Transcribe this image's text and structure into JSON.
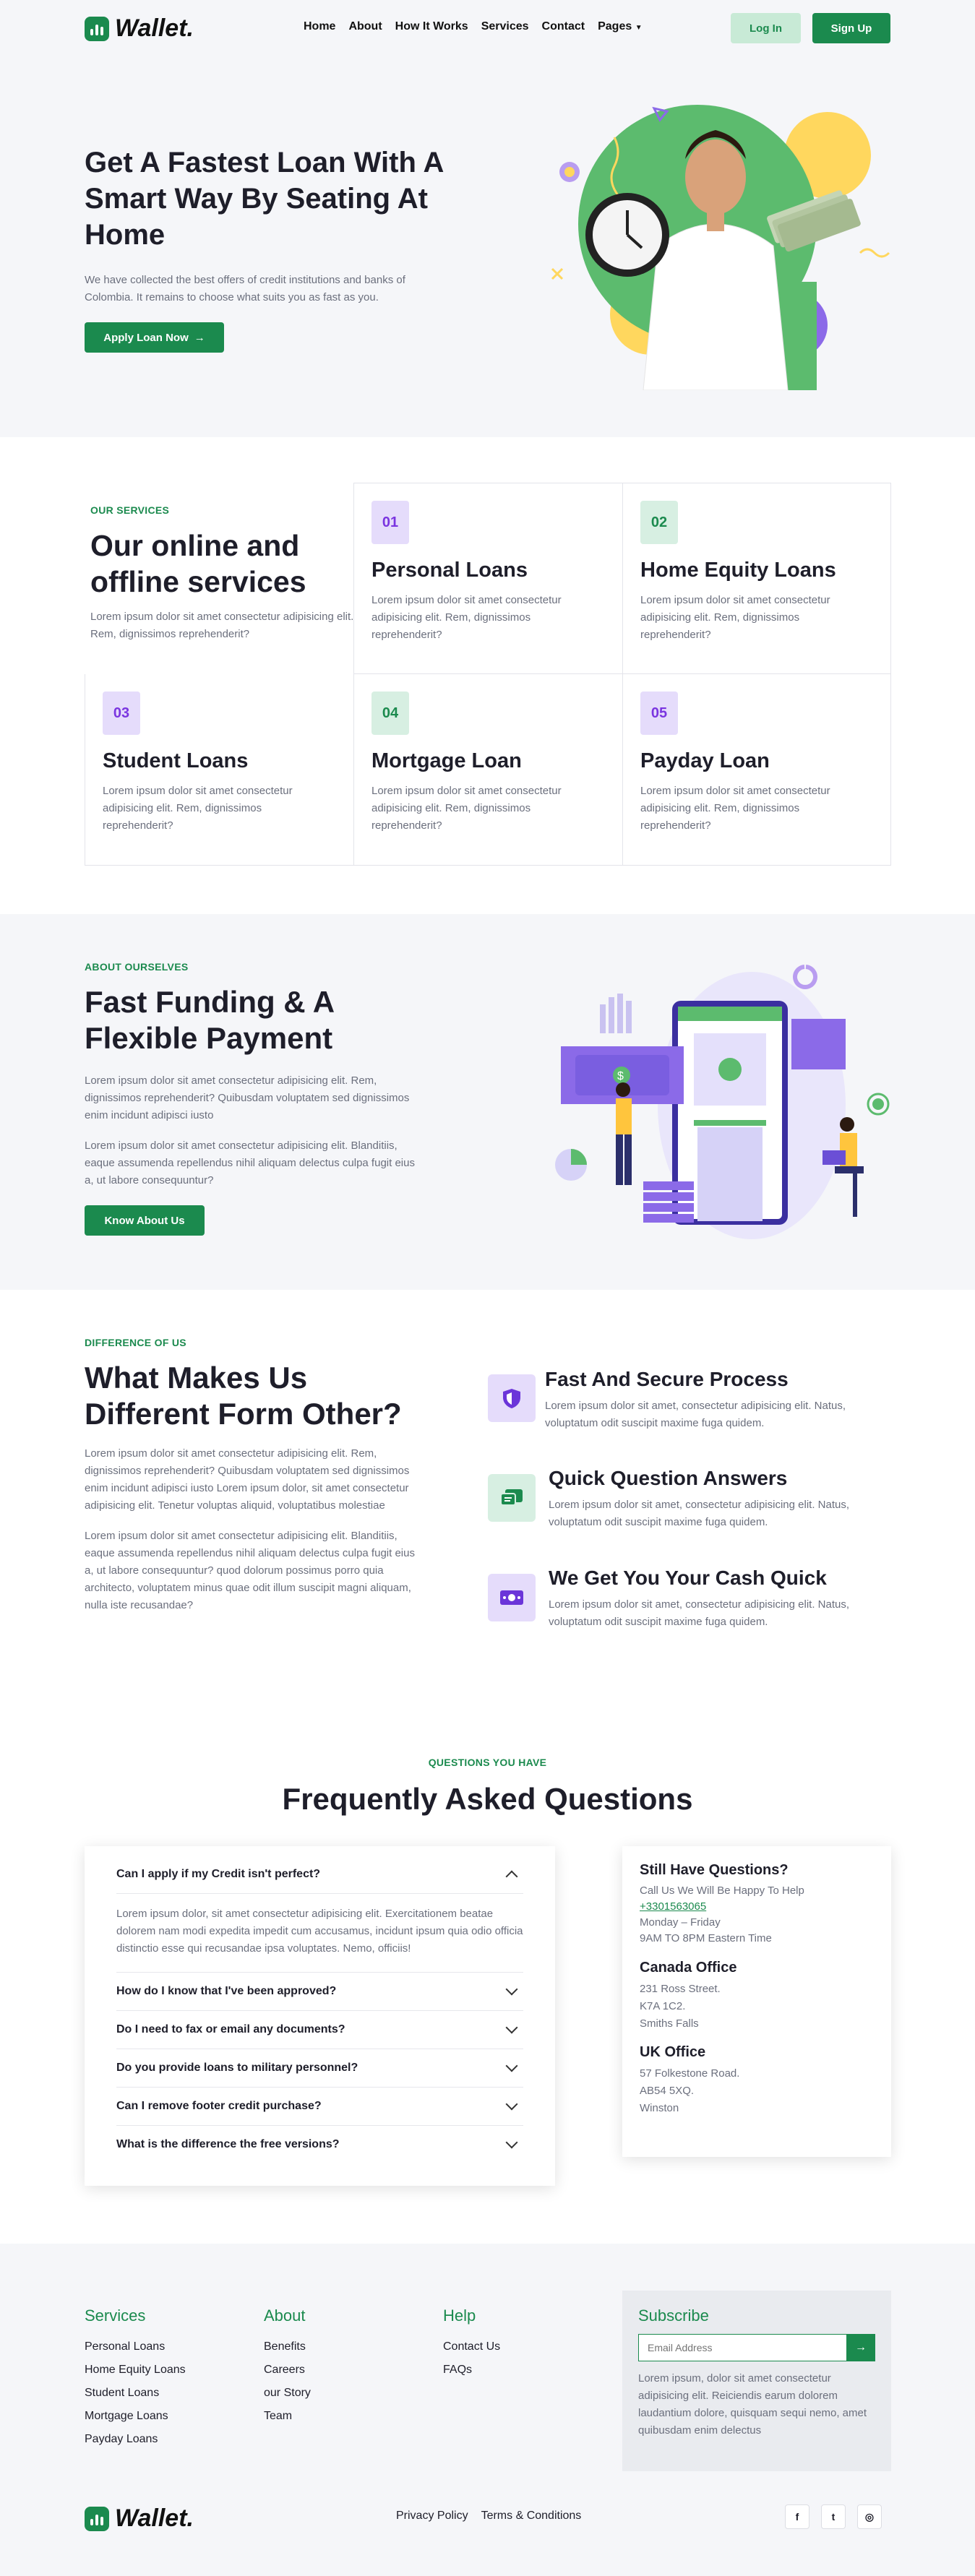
{
  "brand": {
    "logo_text": "Wallet.",
    "accent": "#1b8a4e",
    "purple": "#7a35e0"
  },
  "nav": {
    "items": [
      "Home",
      "About",
      "How It Works",
      "Services",
      "Contact",
      "Pages"
    ],
    "login": "Log In",
    "signup": "Sign Up"
  },
  "hero": {
    "title": "Get A Fastest Loan With A Smart Way By Seating At Home",
    "text": "We have collected the best offers of credit institutions and banks of Colombia. It remains to choose what suits you as fast as you.",
    "cta": "Apply Loan Now"
  },
  "services": {
    "tag": "OUR SERVICES",
    "title": "Our online and offline services",
    "text": "Lorem ipsum dolor sit amet consectetur adipisicing elit. Rem, dignissimos reprehenderit?",
    "items": [
      {
        "num": "01",
        "title": "Personal Loans",
        "desc": "Lorem ipsum dolor sit amet consectetur adipisicing elit. Rem, dignissimos reprehenderit?"
      },
      {
        "num": "02",
        "title": "Home Equity Loans",
        "desc": "Lorem ipsum dolor sit amet consectetur adipisicing elit. Rem, dignissimos reprehenderit?"
      },
      {
        "num": "03",
        "title": "Student Loans",
        "desc": "Lorem ipsum dolor sit amet consectetur adipisicing elit. Rem, dignissimos reprehenderit?"
      },
      {
        "num": "04",
        "title": "Mortgage Loan",
        "desc": "Lorem ipsum dolor sit amet consectetur adipisicing elit. Rem, dignissimos reprehenderit?"
      },
      {
        "num": "05",
        "title": "Payday Loan",
        "desc": "Lorem ipsum dolor sit amet consectetur adipisicing elit. Rem, dignissimos reprehenderit?"
      }
    ]
  },
  "about": {
    "tag": "ABOUT OURSELVES",
    "title": "Fast Funding & A Flexible Payment",
    "p1": "Lorem ipsum dolor sit amet consectetur adipisicing elit. Rem, dignissimos reprehenderit? Quibusdam voluptatem sed dignissimos enim incidunt adipisci iusto",
    "p2": "Lorem ipsum dolor sit amet consectetur adipisicing elit. Blanditiis, eaque assumenda repellendus nihil aliquam delectus culpa fugit eius a, ut labore consequuntur?",
    "cta": "Know About Us",
    "illustration_icon": "dollar-icon"
  },
  "difference": {
    "tag": "DIFFERENCE OF US",
    "title": "What Makes Us Different Form Other?",
    "p1": "Lorem ipsum dolor sit amet consectetur adipisicing elit. Rem, dignissimos reprehenderit? Quibusdam voluptatem sed dignissimos enim incidunt adipisci iusto Lorem ipsum dolor, sit amet consectetur adipisicing elit. Tenetur voluptas aliquid, voluptatibus molestiae",
    "p2": "Lorem ipsum dolor sit amet consectetur adipisicing elit. Blanditiis, eaque assumenda repellendus nihil aliquam delectus culpa fugit eius a, ut labore consequuntur? quod dolorum possimus porro quia architecto, voluptatem minus quae odit illum suscipit magni aliquam, nulla iste recusandae?",
    "features": [
      {
        "icon": "shield-icon",
        "title": "Fast And Secure Process",
        "desc": "Lorem ipsum dolor sit amet, consectetur adipisicing elit. Natus, voluptatum odit suscipit maxime fuga quidem."
      },
      {
        "icon": "chat-icon",
        "title": "Quick Question Answers",
        "desc": "Lorem ipsum dolor sit amet, consectetur adipisicing elit. Natus, voluptatum odit suscipit maxime fuga quidem."
      },
      {
        "icon": "cash-icon",
        "title": "We Get You Your Cash Quick",
        "desc": "Lorem ipsum dolor sit amet, consectetur adipisicing elit. Natus, voluptatum odit suscipit maxime fuga quidem."
      }
    ]
  },
  "faq": {
    "tag": "QUESTIONS YOU HAVE",
    "title": "Frequently Asked Questions",
    "open_q": "Can I apply if my Credit isn't perfect?",
    "open_a": "Lorem ipsum dolor, sit amet consectetur adipisicing elit. Exercitationem beatae dolorem nam modi expedita impedit cum accusamus, incidunt ipsum quia odio officia distinctio esse qui recusandae ipsa voluptates. Nemo, officiis!",
    "items": [
      "How do I know that I've been approved?",
      "Do I need to fax or email any documents?",
      "Do you provide loans to military personnel?",
      "Can I remove footer credit purchase?",
      "What is the difference the free versions?"
    ]
  },
  "contact_card": {
    "title": "Still Have Questions?",
    "sub": "Call Us We Will Be Happy To Help",
    "phone": "+3301563065",
    "days": "Monday – Friday",
    "hours": "9AM TO 8PM Eastern Time",
    "canada_title": "Canada Office",
    "canada_lines": [
      "231 Ross Street.",
      "K7A 1C2.",
      "Smiths Falls"
    ],
    "uk_title": "UK Office",
    "uk_lines": [
      "57 Folkestone Road.",
      "AB54 5XQ.",
      "Winston"
    ]
  },
  "footer": {
    "services_title": "Services",
    "services": [
      "Personal Loans",
      "Home Equity Loans",
      "Student Loans",
      "Mortgage Loans",
      "Payday Loans"
    ],
    "about_title": "About",
    "about": [
      "Benefits",
      "Careers",
      "our Story",
      "Team"
    ],
    "help_title": "Help",
    "help": [
      "Contact Us",
      "FAQs"
    ],
    "subscribe_title": "Subscribe",
    "email_placeholder": "Email Address",
    "subscribe_text": "Lorem ipsum, dolor sit amet consectetur adipisicing elit. Reiciendis earum dolorem laudantium dolore, quisquam sequi nemo, amet quibusdam enim delectus",
    "logo_text": "Wallet.",
    "privacy": "Privacy Policy",
    "terms": "Terms & Conditions",
    "social": [
      "f",
      "t",
      "◎"
    ],
    "social_icons": [
      "facebook-icon",
      "twitter-icon",
      "instagram-icon"
    ]
  }
}
